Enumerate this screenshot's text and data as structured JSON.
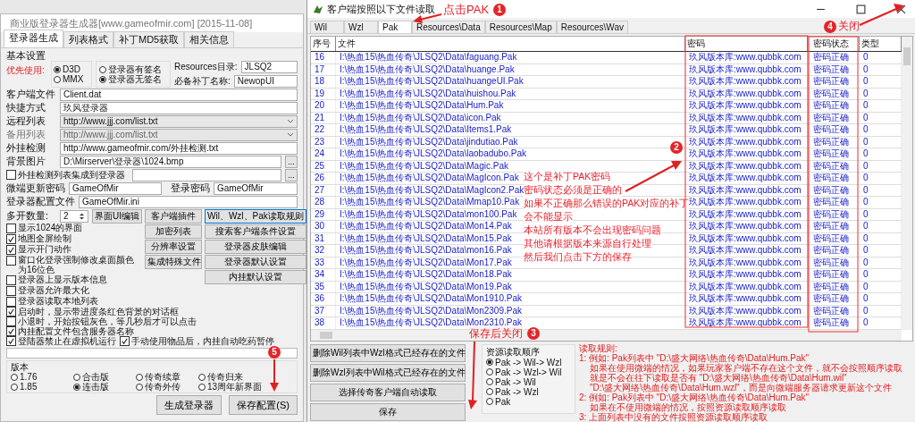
{
  "left_window": {
    "title": "商业版登录器生成器[www.gameofmir.com] [2015-11-08]",
    "tabs": [
      {
        "label": "登录器生成",
        "selected": true
      },
      {
        "label": "列表格式",
        "selected": false
      },
      {
        "label": "补丁MD5获取",
        "selected": false
      },
      {
        "label": "相关信息",
        "selected": false
      }
    ],
    "group_label": "基本设置",
    "priority": {
      "label": "优先使用:",
      "options": [
        {
          "label": "D3D",
          "selected": true
        },
        {
          "label": "MMX",
          "selected": false
        }
      ]
    },
    "signature_options": [
      {
        "label": "登录器有签名",
        "selected": false
      },
      {
        "label": "登录器无签名",
        "selected": true
      }
    ],
    "resources_dir": {
      "label": "Resources目录:",
      "value": "JLSQ2"
    },
    "patch_name": {
      "label": "必备补丁名称:",
      "value": "NewopUI"
    },
    "fields": [
      {
        "kind": "text",
        "label": "客户端文件",
        "value": "Client.dat",
        "disabled": false
      },
      {
        "kind": "text",
        "label": "快捷方式",
        "value": "玖风登录器",
        "disabled": false
      },
      {
        "kind": "dropdown",
        "label": "远程列表",
        "value": "http://www.jjj.com/list.txt",
        "disabled": false
      },
      {
        "kind": "dropdown",
        "label": "备用列表",
        "value": "http://www.jjj.com/list.txt",
        "disabled": true
      },
      {
        "kind": "text",
        "label": "外挂检测",
        "value": "http://www.gameofmir.com/外挂检测.txt",
        "disabled": false
      },
      {
        "kind": "browse",
        "label": "背景图片",
        "value": "D:\\Mirserver\\登录器\\1024.bmp",
        "button": "...",
        "disabled": false
      }
    ],
    "plugin_list": {
      "label": "外挂检测列表集成到登录器",
      "checked": false,
      "button": "..."
    },
    "update_password": {
      "label": "微端更新密码",
      "value": "GameOfMir"
    },
    "login_password": {
      "label": "登录密码",
      "value": "GameOfMir"
    },
    "config_file": {
      "label": "登录器配置文件",
      "value": "GameOfMir.ini"
    },
    "instances": {
      "label": "多开数量:",
      "value": "2"
    },
    "ui_button": "界面UI编辑",
    "middle_buttons": [
      "客户端插件",
      "加密列表",
      "分辨率设置",
      "集成特殊文件"
    ],
    "right_buttons": [
      {
        "label": "Wil、Wzl、Pak读取规则",
        "focused": true
      },
      {
        "label": "搜索客户端条件设置",
        "focused": false
      },
      {
        "label": "登录器皮肤编辑",
        "focused": false
      },
      {
        "label": "登录器默认设置",
        "focused": false
      },
      {
        "label": "内挂默认设置",
        "focused": false
      }
    ],
    "option_lines": [
      [
        {
          "label": "显示1024的界面",
          "checked": false
        },
        {
          "label": "地图全屏绘制",
          "checked": true
        }
      ],
      [
        {
          "label": "显示开门动作",
          "checked": true
        }
      ],
      [
        {
          "label": "窗口化登录强制修改桌面颜色为16位色",
          "checked": false
        }
      ],
      [
        {
          "label": "登录器上显示版本信息",
          "checked": false
        }
      ],
      [
        {
          "label": "登录器允许最大化",
          "checked": false
        }
      ],
      [
        {
          "label": "登录器读取本地列表",
          "checked": false
        }
      ]
    ],
    "wide_option_lines": [
      [
        {
          "label": "启动时，显示带进度条红色背景的对话框",
          "checked": true
        }
      ],
      [
        {
          "label": "小退时，开始按钮灰色，等几秒后才可以点击",
          "checked": false
        },
        {
          "label": "内挂配置文件包含服务器名称",
          "checked": true
        }
      ],
      [
        {
          "label": "登陆器禁止在虚拟机运行",
          "checked": true
        },
        {
          "label": "手动使用物品后，内挂自动吃药暂停",
          "checked": true
        }
      ]
    ],
    "version": {
      "label": "版本",
      "options": [
        {
          "label": "1.76",
          "selected": false
        },
        {
          "label": "合击版",
          "selected": false
        },
        {
          "label": "传奇续章",
          "selected": false
        },
        {
          "label": "传奇归来",
          "selected": false
        },
        {
          "label": "1.85",
          "selected": false
        },
        {
          "label": "连击版",
          "selected": true
        },
        {
          "label": "传奇外传",
          "selected": false
        },
        {
          "label": "13周年新界面",
          "selected": false
        }
      ]
    },
    "buttons": [
      "生成登录器",
      "保存配置(S)"
    ]
  },
  "right_window": {
    "title": "客户端按照以下文件读取",
    "tabs": [
      {
        "label": "Wil",
        "selected": false
      },
      {
        "label": "Wzl",
        "selected": false
      },
      {
        "label": "Pak",
        "selected": true
      },
      {
        "label": "Resources\\Data",
        "selected": false
      },
      {
        "label": "Resources\\Map",
        "selected": false
      },
      {
        "label": "Resources\\Wav",
        "selected": false
      }
    ],
    "table": {
      "columns": [
        "序号",
        "文件",
        "密码",
        "密码状态",
        "类型"
      ],
      "rows": [
        {
          "no": "16",
          "file": "I:\\热血15\\热血传奇\\JLSQ2\\Data\\faguang.Pak",
          "password": "玖风版本库:www.qubbk.com",
          "status": "密码正确",
          "type": "0"
        },
        {
          "no": "17",
          "file": "I:\\热血15\\热血传奇\\JLSQ2\\Data\\huange.Pak",
          "password": "玖风版本库:www.qubbk.com",
          "status": "密码正确",
          "type": "0"
        },
        {
          "no": "18",
          "file": "I:\\热血15\\热血传奇\\JLSQ2\\Data\\huangeUI.Pak",
          "password": "玖风版本库:www.qubbk.com",
          "status": "密码正确",
          "type": "0"
        },
        {
          "no": "19",
          "file": "I:\\热血15\\热血传奇\\JLSQ2\\Data\\huishou.Pak",
          "password": "玖风版本库:www.qubbk.com",
          "status": "密码正确",
          "type": "0"
        },
        {
          "no": "20",
          "file": "I:\\热血15\\热血传奇\\JLSQ2\\Data\\Hum.Pak",
          "password": "玖风版本库:www.qubbk.com",
          "status": "密码正确",
          "type": "0"
        },
        {
          "no": "21",
          "file": "I:\\热血15\\热血传奇\\JLSQ2\\Data\\icon.Pak",
          "password": "玖风版本库:www.qubbk.com",
          "status": "密码正确",
          "type": "0"
        },
        {
          "no": "22",
          "file": "I:\\热血15\\热血传奇\\JLSQ2\\Data\\Items1.Pak",
          "password": "玖风版本库:www.qubbk.com",
          "status": "密码正确",
          "type": "0"
        },
        {
          "no": "23",
          "file": "I:\\热血15\\热血传奇\\JLSQ2\\Data\\jindutiao.Pak",
          "password": "玖风版本库:www.qubbk.com",
          "status": "密码正确",
          "type": "0"
        },
        {
          "no": "24",
          "file": "I:\\热血15\\热血传奇\\JLSQ2\\Data\\laobadubo.Pak",
          "password": "玖风版本库:www.qubbk.com",
          "status": "密码正确",
          "type": "0"
        },
        {
          "no": "25",
          "file": "I:\\热血15\\热血传奇\\JLSQ2\\Data\\Magic.Pak",
          "password": "玖风版本库:www.qubbk.com",
          "status": "密码正确",
          "type": "0"
        },
        {
          "no": "26",
          "file": "I:\\热血15\\热血传奇\\JLSQ2\\Data\\MagIcon.Pak",
          "password": "玖风版本库:www.qubbk.com",
          "status": "密码正确",
          "type": "0"
        },
        {
          "no": "27",
          "file": "I:\\热血15\\热血传奇\\JLSQ2\\Data\\MagIcon2.Pak",
          "password": "玖风版本库:www.qubbk.com",
          "status": "密码正确",
          "type": "0"
        },
        {
          "no": "28",
          "file": "I:\\热血15\\热血传奇\\JLSQ2\\Data\\Mmap10.Pak",
          "password": "玖风版本库:www.qubbk.com",
          "status": "密码正确",
          "type": "0"
        },
        {
          "no": "29",
          "file": "I:\\热血15\\热血传奇\\JLSQ2\\Data\\mon100.Pak",
          "password": "玖风版本库:www.qubbk.com",
          "status": "密码正确",
          "type": "0"
        },
        {
          "no": "30",
          "file": "I:\\热血15\\热血传奇\\JLSQ2\\Data\\Mon14.Pak",
          "password": "玖风版本库:www.qubbk.com",
          "status": "密码正确",
          "type": "0"
        },
        {
          "no": "31",
          "file": "I:\\热血15\\热血传奇\\JLSQ2\\Data\\Mon15.Pak",
          "password": "玖风版本库:www.qubbk.com",
          "status": "密码正确",
          "type": "0"
        },
        {
          "no": "32",
          "file": "I:\\热血15\\热血传奇\\JLSQ2\\Data\\mon16.Pak",
          "password": "玖风版本库:www.qubbk.com",
          "status": "密码正确",
          "type": "0"
        },
        {
          "no": "33",
          "file": "I:\\热血15\\热血传奇\\JLSQ2\\Data\\Mon17.Pak",
          "password": "玖风版本库:www.qubbk.com",
          "status": "密码正确",
          "type": "0"
        },
        {
          "no": "34",
          "file": "I:\\热血15\\热血传奇\\JLSQ2\\Data\\Mon18.Pak",
          "password": "玖风版本库:www.qubbk.com",
          "status": "密码正确",
          "type": "0"
        },
        {
          "no": "35",
          "file": "I:\\热血15\\热血传奇\\JLSQ2\\Data\\Mon19.Pak",
          "password": "玖风版本库:www.qubbk.com",
          "status": "密码正确",
          "type": "0"
        },
        {
          "no": "36",
          "file": "I:\\热血15\\热血传奇\\JLSQ2\\Data\\Mon1910.Pak",
          "password": "玖风版本库:www.qubbk.com",
          "status": "密码正确",
          "type": "0"
        },
        {
          "no": "37",
          "file": "I:\\热血15\\热血传奇\\JLSQ2\\Data\\Mon2309.Pak",
          "password": "玖风版本库:www.qubbk.com",
          "status": "密码正确",
          "type": "0"
        },
        {
          "no": "38",
          "file": "I:\\热血15\\热血传奇\\JLSQ2\\Data\\Mon2310.Pak",
          "password": "玖风版本库:www.qubbk.com",
          "status": "密码正确",
          "type": "0"
        }
      ]
    },
    "bottom_buttons": [
      "删除Wil列表中Wzl格式已经存在的文件",
      "删除Wzl列表中Wil格式已经存在的文件",
      "选择传奇客户端自动读取",
      "保存"
    ],
    "read_order": {
      "label": "资源读取顺序",
      "options": [
        {
          "label": "Pak -> Wil-> Wzl",
          "selected": true
        },
        {
          "label": "Pak -> Wzl-> Wil",
          "selected": false
        },
        {
          "label": "Pak -> Wil",
          "selected": false
        },
        {
          "label": "Pak -> Wzl",
          "selected": false
        },
        {
          "label": "Pak",
          "selected": false
        }
      ]
    },
    "rules": [
      "读取规则:",
      "1: 例如: Pak列表中 \"D:\\盛大网络\\热血传奇\\Data\\Hum.Pak\"",
      "如果在使用微端的情况，如果玩家客户端不存在这个文件，就不会按照顺序读取",
      "就是不会在往下读取是否有 \"D:\\盛大网络\\热血传奇\\Data\\Hum.wil\"",
      "\"D:\\盛大网络\\热血传奇\\Data\\Hum.wzl\"，而是向微端服务器请求更新这个文件",
      "2: 例如: Pak列表中 \"D:\\盛大网络\\热血传奇\\Data\\Hum.Pak\"",
      "如果在不使用微端的情况，按照资源读取顺序读取",
      "3: 上面列表中没有的文件按照资源读取顺序读取"
    ]
  },
  "annotations": {
    "click_pak": "点击PAK",
    "note_lines": [
      "这个是补丁PAK密码",
      "密码状态必须是正确的",
      "如果不正确那么错误的PAK对应的补丁",
      "会不能显示",
      "本站所有版本不会出现密码问题",
      "其他请根据版本来源自行处理",
      "然后我们点击下方的保存"
    ],
    "save_close": "保存后关闭",
    "close": "关闭",
    "badges": [
      "1",
      "2",
      "3",
      "4",
      "5"
    ]
  }
}
